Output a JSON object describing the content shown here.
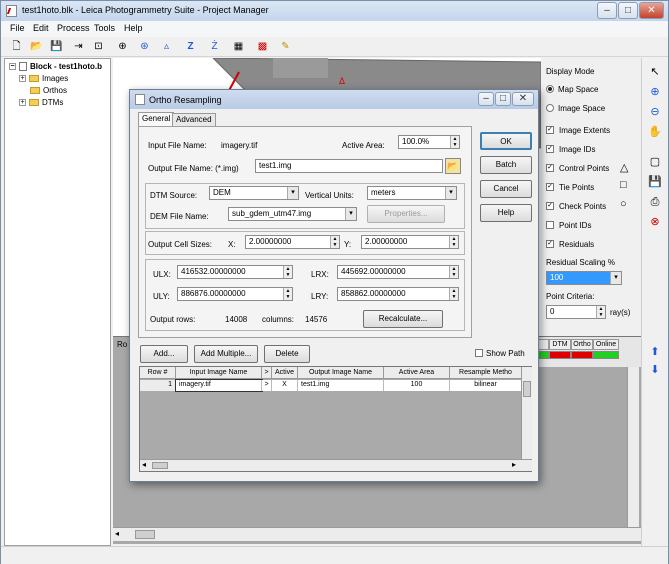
{
  "window": {
    "title": "test1hoto.blk - Leica Photogrammetry Suite - Project Manager",
    "controls": [
      "–",
      "□",
      "✕"
    ]
  },
  "menu": [
    "File",
    "Edit",
    "Process",
    "Tools",
    "Help"
  ],
  "tree": {
    "root": "Block - test1hoto.b",
    "children": [
      "Images",
      "Orthos",
      "DTMs"
    ]
  },
  "canvas": {
    "marker": "Δ"
  },
  "cell_headers": [
    "DTM",
    "Ortho",
    "Online"
  ],
  "lower_pane_label": "Ro",
  "right_panel": {
    "display_mode_label": "Display Mode",
    "map_space": "Map Space",
    "image_space": "Image Space",
    "options": [
      {
        "label": "Image Extents",
        "checked": true
      },
      {
        "label": "Image IDs",
        "checked": true
      },
      {
        "label": "Control Points",
        "checked": true
      },
      {
        "label": "Tie Points",
        "checked": true
      },
      {
        "label": "Check Points",
        "checked": true
      },
      {
        "label": "Point IDs",
        "checked": false
      },
      {
        "label": "Residuals",
        "checked": true
      }
    ],
    "residual_scaling_label": "Residual Scaling %",
    "residual_scaling_value": "100",
    "point_criteria_label": "Point Criteria:",
    "point_criteria_value": "0",
    "point_criteria_unit": "ray(s)"
  },
  "dialog": {
    "title": "Ortho Resampling",
    "controls": [
      "–",
      "□",
      "✕"
    ],
    "tabs": [
      "General",
      "Advanced"
    ],
    "input_file_label": "Input File Name:",
    "input_file_value": "imagery.tif",
    "active_area_label": "Active Area:",
    "active_area_value": "100.0%",
    "output_file_label": "Output File Name: (*.img)",
    "output_file_value": "test1.img",
    "dtm_source_label": "DTM Source:",
    "dtm_source_value": "DEM",
    "vertical_units_label": "Vertical Units:",
    "vertical_units_value": "meters",
    "dem_file_label": "DEM File Name:",
    "dem_file_value": "sub_gdem_utm47.img",
    "properties_button": "Properties...",
    "output_cell_sizes_label": "Output Cell Sizes:",
    "x_label": "X:",
    "x_value": "2.00000000",
    "y_label": "Y:",
    "y_value": "2.00000000",
    "ulx_label": "ULX:",
    "ulx_value": "416532.00000000",
    "lrx_label": "LRX:",
    "lrx_value": "445692.00000000",
    "uly_label": "ULY:",
    "uly_value": "886876.00000000",
    "lry_label": "LRY:",
    "lry_value": "858862.00000000",
    "output_rows_label": "Output rows:",
    "output_rows_value": "14008",
    "columns_label": "columns:",
    "columns_value": "14576",
    "recalculate_button": "Recalculate...",
    "buttons": {
      "ok": "OK",
      "batch": "Batch",
      "cancel": "Cancel",
      "help": "Help"
    },
    "add_button": "Add...",
    "add_multiple_button": "Add Multiple...",
    "delete_button": "Delete",
    "show_path_label": "Show Path",
    "grid": {
      "columns": [
        "Row #",
        "Input Image Name",
        ">",
        "Active",
        "Output Image Name",
        "Active Area",
        "Resample Metho"
      ],
      "rows": [
        [
          "1",
          "imagery.tif",
          ">",
          "X",
          "test1.img",
          "100",
          "bilinear"
        ]
      ]
    }
  },
  "colors": {
    "status_red": "#e00000",
    "status_green": "#1fd11f",
    "accent_blue": "#1e5ad6"
  }
}
